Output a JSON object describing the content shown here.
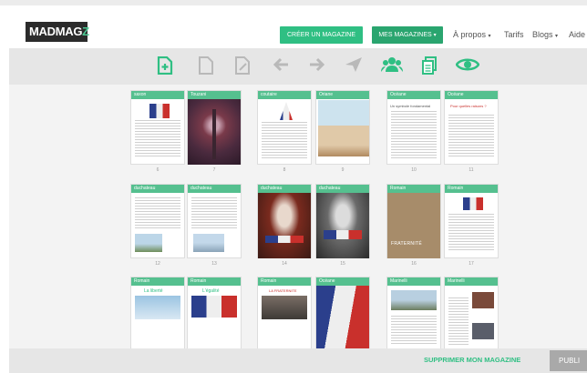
{
  "header": {
    "logo_main": "MADMAG",
    "logo_accent": "Z",
    "create_button": "CRÉER UN MAGAZINE",
    "my_magazines_button": "MES MAGAZINES",
    "nav": {
      "about": "À propos",
      "pricing": "Tarifs",
      "blogs": "Blogs",
      "help": "Aide"
    }
  },
  "toolbar": {
    "icons": [
      "add-page-icon",
      "page-icon",
      "edit-page-icon",
      "arrow-left-icon",
      "arrow-right-icon",
      "send-icon",
      "users-icon",
      "copy-icon",
      "eye-icon"
    ]
  },
  "pages": {
    "labels": [
      "saxon",
      "Touzani",
      "coutaire",
      "Oriane",
      "Océane",
      "Océane",
      "duchateau",
      "duchateau",
      "duchateau",
      "duchateau",
      "Romain",
      "Romain",
      "Romain",
      "Romain",
      "Romain",
      "Océane",
      "Marinelli",
      "Marinelli"
    ],
    "numbers": [
      "6",
      "7",
      "8",
      "9",
      "10",
      "11",
      "12",
      "13",
      "14",
      "15",
      "16",
      "17"
    ],
    "headlines": {
      "p10": "Un symbole fondamental",
      "p11": "Pour quelles raisons ?",
      "p18": "La liberté",
      "p19": "L'égalité",
      "p20": "LA FRATERNITE",
      "p16_fraternite": "FRATERNITÉ"
    }
  },
  "footer": {
    "delete_button": "SUPPRIMER MON MAGAZINE",
    "publish_button": "PUBLI"
  },
  "colors": {
    "accent": "#2fbf83",
    "accent_dark": "#2aa56f",
    "toolbar_bg": "#e6e6e6"
  }
}
